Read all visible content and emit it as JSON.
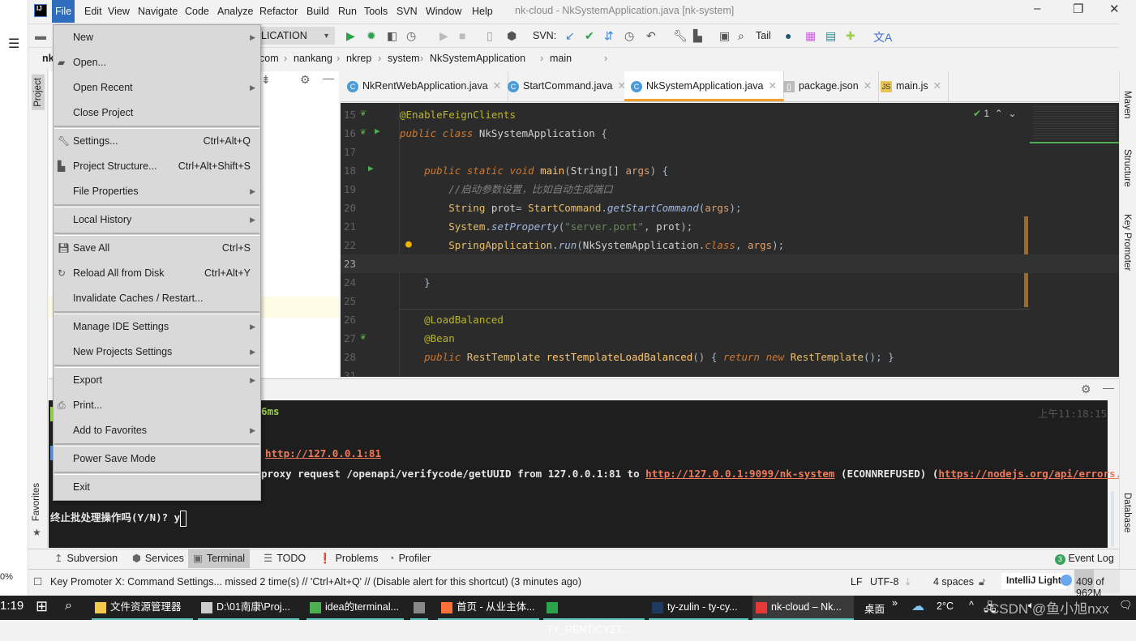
{
  "colors": {
    "accent": "#2f6cbd",
    "editor_bg": "#2b2b2b",
    "terminal_bg": "#1e1e1e",
    "link": "#ef7b5b",
    "active_tab": "#f0a030"
  },
  "window": {
    "title": "nk-cloud - NkSystemApplication.java [nk-system]",
    "logo": "IJ"
  },
  "menubar": [
    "File",
    "Edit",
    "View",
    "Navigate",
    "Code",
    "Analyze",
    "Refactor",
    "Build",
    "Run",
    "Tools",
    "SVN",
    "Window",
    "Help"
  ],
  "toolbar": {
    "run_config": "LICATION",
    "svn_label": "SVN:",
    "tail_label": "Tail"
  },
  "breadcrumb": [
    "nk",
    "com",
    "nankang",
    "nkrep",
    "system",
    "NkSystemApplication",
    "main"
  ],
  "project_tool": "Project",
  "favorites_tool": "Favorites",
  "tabs": [
    {
      "label": "NkRentWebApplication.java",
      "icon": "C"
    },
    {
      "label": "StartCommand.java",
      "icon": "C"
    },
    {
      "label": "NkSystemApplication.java",
      "icon": "C",
      "active": true
    },
    {
      "label": "package.json",
      "icon": "{}"
    },
    {
      "label": "main.js",
      "icon": "JS"
    }
  ],
  "editor": {
    "inspection_count": "1",
    "lines": [
      {
        "n": "15",
        "tokens": [
          [
            "an",
            "@EnableFeignClients"
          ]
        ]
      },
      {
        "n": "16",
        "tokens": [
          [
            "kw",
            "public class "
          ],
          [
            "dflt",
            "NkSystemApplication "
          ],
          [
            "pl",
            "{"
          ]
        ]
      },
      {
        "n": "17",
        "tokens": []
      },
      {
        "n": "18",
        "tokens": [
          [
            "kw",
            "    public static void "
          ],
          [
            "fn",
            "main"
          ],
          [
            "pl",
            "("
          ],
          [
            "dflt",
            "String[] "
          ],
          [
            "param",
            "args"
          ],
          [
            "pl",
            ") {"
          ]
        ]
      },
      {
        "n": "19",
        "tokens": [
          [
            "cm",
            "        //启动参数设置，比如自动生成端口"
          ]
        ]
      },
      {
        "n": "20",
        "tokens": [
          [
            "cls",
            "        String "
          ],
          [
            "dflt",
            "prot"
          ],
          [
            "pl",
            "= "
          ],
          [
            "cls",
            "StartCommand"
          ],
          [
            "pl",
            "."
          ],
          [
            "mth",
            "getStartCommand"
          ],
          [
            "pl",
            "("
          ],
          [
            "param",
            "args"
          ],
          [
            "pl",
            ");"
          ]
        ]
      },
      {
        "n": "21",
        "tokens": [
          [
            "cls",
            "        System"
          ],
          [
            "pl",
            "."
          ],
          [
            "mth",
            "setProperty"
          ],
          [
            "pl",
            "("
          ],
          [
            "str",
            "\"server.port\""
          ],
          [
            "pl",
            ", "
          ],
          [
            "dflt",
            "prot"
          ],
          [
            "pl",
            ");"
          ]
        ]
      },
      {
        "n": "22",
        "tokens": [
          [
            "cls",
            "        SpringApplication"
          ],
          [
            "pl",
            "."
          ],
          [
            "mth",
            "run"
          ],
          [
            "pl",
            "("
          ],
          [
            "dflt",
            "NkSystemApplication"
          ],
          [
            "pl",
            "."
          ],
          [
            "kw",
            "class"
          ],
          [
            "pl",
            ", "
          ],
          [
            "param",
            "args"
          ],
          [
            "pl",
            ");"
          ]
        ]
      },
      {
        "n": "23",
        "tokens": [],
        "current": true
      },
      {
        "n": "24",
        "tokens": [
          [
            "pl",
            "    }"
          ]
        ]
      },
      {
        "n": "25",
        "tokens": []
      },
      {
        "n": "26",
        "tokens": [
          [
            "an",
            "    @LoadBalanced"
          ]
        ]
      },
      {
        "n": "27",
        "tokens": [
          [
            "an",
            "    @Bean"
          ]
        ]
      },
      {
        "n": "28",
        "tokens": [
          [
            "kw",
            "    public "
          ],
          [
            "cls",
            "RestTemplate "
          ],
          [
            "fn",
            "restTemplateLoadBalanced"
          ],
          [
            "pl",
            "() { "
          ],
          [
            "kw",
            "return new "
          ],
          [
            "cls",
            "RestTemplate"
          ],
          [
            "pl",
            "(); }"
          ]
        ]
      },
      {
        "n": "31",
        "tokens": []
      }
    ]
  },
  "terminal": {
    "timestamp": "上午11:18:15",
    "line1": "6ms",
    "line2_link": "http://127.0.0.1:81",
    "line3_pre": "proxy request /openapi/verifycode/getUUID from 127.0.0.1:81 to ",
    "line3_link1": "http://127.0.0.1:9099/nk-system",
    "line3_mid": " (ECONNREFUSED) (",
    "line3_link2": "https://nodejs.org/api/errors.html#err",
    "prompt": "终止批处理操作吗(Y/N)? y"
  },
  "bottom_tabs": [
    {
      "label": "Subversion",
      "icon": "↥"
    },
    {
      "label": "Services",
      "icon": "⬢"
    },
    {
      "label": "Terminal",
      "icon": "▣",
      "active": true
    },
    {
      "label": "TODO",
      "icon": "☰"
    },
    {
      "label": "Problems",
      "icon": "❗"
    },
    {
      "label": "Profiler",
      "icon": "◔"
    }
  ],
  "event_log": {
    "label": "Event Log",
    "count": "3"
  },
  "status": {
    "message": "Key Promoter X: Command Settings... missed 2 time(s) // 'Ctrl+Alt+Q' // (Disable alert for this shortcut) (3 minutes ago)",
    "line_sep": "LF",
    "encoding": "UTF-8",
    "indent": "4 spaces",
    "theme": "IntelliJ Light",
    "memory": "409 of 962M",
    "memory_used_fraction": 0.425
  },
  "right_tools": [
    "Maven",
    "Structure",
    "Key Promoter",
    "Database"
  ],
  "file_menu": [
    {
      "label": "New",
      "submenu": true
    },
    {
      "label": "Open...",
      "icon": "folder-icon"
    },
    {
      "label": "Open Recent",
      "submenu": true
    },
    {
      "label": "Close Project"
    },
    {
      "sep": true
    },
    {
      "label": "Settings...",
      "shortcut": "Ctrl+Alt+Q",
      "icon": "wrench-icon"
    },
    {
      "label": "Project Structure...",
      "shortcut": "Ctrl+Alt+Shift+S",
      "icon": "project-structure-icon"
    },
    {
      "label": "File Properties",
      "submenu": true
    },
    {
      "sep": true
    },
    {
      "label": "Local History",
      "submenu": true
    },
    {
      "sep": true
    },
    {
      "label": "Save All",
      "shortcut": "Ctrl+S",
      "icon": "save-icon"
    },
    {
      "label": "Reload All from Disk",
      "shortcut": "Ctrl+Alt+Y",
      "icon": "reload-icon"
    },
    {
      "label": "Invalidate Caches / Restart..."
    },
    {
      "sep": true
    },
    {
      "label": "Manage IDE Settings",
      "submenu": true
    },
    {
      "label": "New Projects Settings",
      "submenu": true
    },
    {
      "sep": true
    },
    {
      "label": "Export",
      "submenu": true
    },
    {
      "label": "Print...",
      "icon": "print-icon"
    },
    {
      "label": "Add to Favorites",
      "submenu": true
    },
    {
      "sep": true
    },
    {
      "label": "Power Save Mode"
    },
    {
      "sep": true
    },
    {
      "label": "Exit"
    }
  ],
  "taskbar": {
    "clock_partial": "1:19",
    "zoom_partial": "0%",
    "items": [
      {
        "label": "文件资源管理器"
      },
      {
        "label": "D:\\01南康\\Proj..."
      },
      {
        "label": "idea的terminal..."
      },
      {
        "label": ""
      },
      {
        "label": "首页 - 从业主体..."
      },
      {
        "label": "TY_RENT/CYZT..."
      },
      {
        "label": "ty-zulin - ty-cy..."
      },
      {
        "label": "nk-cloud – Nk...",
        "active": true
      }
    ],
    "desktop": "桌面",
    "weather": "2°C",
    "watermark": "CSDN @鱼小旭nxx"
  }
}
